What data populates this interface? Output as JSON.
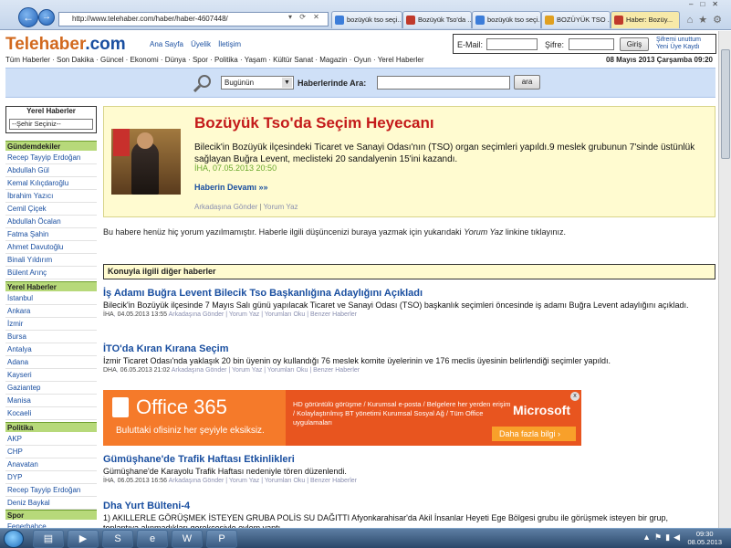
{
  "browser": {
    "url": "http://www.telehaber.com/haber/haber-4607448/",
    "tabs": [
      {
        "title": "bozüyük tso seçi...",
        "color": "#3c7dd9"
      },
      {
        "title": "Bozüyük Tso'da ...",
        "color": "#c0392b"
      },
      {
        "title": "bozüyük tso seçi...",
        "color": "#3c7dd9"
      },
      {
        "title": "BOZÜYÜK TSO ...",
        "color": "#e0a020"
      },
      {
        "title": "Haber: Bozüy...",
        "color": "#c0392b",
        "active": true
      }
    ]
  },
  "header": {
    "logo_main": "Telehaber",
    "logo_dot": ".com",
    "links": [
      "Ana Sayfa",
      "Üyelik",
      "İletişim"
    ],
    "email_label": "E-Mail:",
    "password_label": "Şifre:",
    "login_button": "Giriş",
    "forgot_line1": "Şifremi unuttum",
    "forgot_line2": "Yeni Üye Kaydı"
  },
  "nav": {
    "items": "Tüm Haberler · Son Dakika · Güncel · Ekonomi · Dünya · Spor · Politika · Yaşam · Kültür Sanat · Magazin · Oyun · Yerel Haberler",
    "date": "08 Mayıs 2013 Çarşamba 09:20"
  },
  "search": {
    "select_value": "Bugünün",
    "label": "Haberlerinde Ara:",
    "button": "ara"
  },
  "sidebar": {
    "regional_title": "Yerel Haberler",
    "regional_select": "--Şehir Seçiniz--",
    "sections": [
      {
        "title": "Gündemdekiler",
        "items": [
          "Recep Tayyip Erdoğan",
          "Abdullah Gül",
          "Kemal Kılıçdaroğlu",
          "İbrahim Yazıcı",
          "Cemil Çiçek",
          "Abdullah Öcalan",
          "Fatma Şahin",
          "Ahmet Davutoğlu",
          "Binali Yıldırım",
          "Bülent Arınç"
        ]
      },
      {
        "title": "Yerel Haberler",
        "items": [
          "İstanbul",
          "Ankara",
          "İzmir",
          "Bursa",
          "Antalya",
          "Adana",
          "Kayseri",
          "Gaziantep",
          "Manisa",
          "Kocaeli"
        ]
      },
      {
        "title": "Politika",
        "items": [
          "AKP",
          "CHP",
          "Anavatan",
          "DYP",
          "Recep Tayyip Erdoğan",
          "Deniz Baykal"
        ]
      },
      {
        "title": "Spor",
        "items": [
          "Fenerbahçe"
        ]
      }
    ]
  },
  "feature": {
    "title": "Bozüyük Tso'da Seçim Heyecanı",
    "summary": "Bilecik'in Bozüyük ilçesindeki Ticaret ve Sanayi Odası'nın (TSO) organ seçimleri yapıldı.9 meslek grubunun 7'sinde üstünlük sağlayan Buğra Levent, meclisteki 20 sandalyenin 15'ini kazandı.",
    "meta": "İHA, 07.05.2013 20:50",
    "more": "Haberin Devamı »»",
    "send": "Arkadaşına Gönder",
    "comment": "Yorum Yaz"
  },
  "no_comment": {
    "text_before": "Bu habere henüz hiç yorum yazılmamıştır. Haberle ilgili düşüncenizi buraya yazmak için yukarıdaki",
    "text_em": "Yorum Yaz",
    "text_after": "linkine tıklayınız."
  },
  "related": {
    "header": "Konuyla ilgili diğer haberler",
    "items": [
      {
        "title": "İş Adamı Buğra Levent Bilecik Tso Başkanlığına Adaylığını Açıkladı",
        "desc": "Bilecik'in Bozüyük ilçesinde 7 Mayıs Salı günü yapılacak Ticaret ve Sanayi Odası (TSO) başkanlık seçimleri öncesinde iş adamı Buğra Levent adaylığını açıkladı.",
        "source": "İHA",
        "date": "04.05.2013 13:55",
        "links": "Arkadaşına Gönder | Yorum Yaz | Yorumları Oku | Benzer Haberler"
      },
      {
        "title": "İTO'da Kıran Kırana Seçim",
        "desc": "İzmir Ticaret Odası'nda yaklaşık 20 bin üyenin oy kullandığı 76 meslek komite üyelerinin ve 176 meclis üyesinin belirlendiği seçimler yapıldı.",
        "source": "DHA",
        "date": "06.05.2013 21:02",
        "links": "Arkadaşına Gönder | Yorum Yaz | Yorumları Oku | Benzer Haberler"
      },
      {
        "title": "Gümüşhane'de Trafik Haftası Etkinlikleri",
        "desc": "Gümüşhane'de Karayolu Trafik Haftası nedeniyle tören düzenlendi.",
        "source": "İHA",
        "date": "06.05.2013 16:56",
        "links": "Arkadaşına Gönder | Yorum Yaz | Yorumları Oku | Benzer Haberler"
      },
      {
        "title": "Dha Yurt Bülteni-4",
        "desc": "1) AKILLERLE GÖRÜŞMEK İSTEYEN GRUBA POLİS SU DAĞITTI Afyonkarahisar'da Akil İnsanlar Heyeti Ege Bölgesi grubu ile görüşmek isteyen bir grup, toplantıya alınmadıkları gerekçesiyle eylem yaptı."
      }
    ]
  },
  "ad": {
    "logo": "Office 365",
    "tagline": "Buluttaki ofisiniz her şeyiyle eksiksiz.",
    "text": "HD görüntülü görüşme / Kurumsal e-posta / Belgelere her yerden erişim / Kolaylaştırılmış BT yönetimi Kurumsal Sosyal Ağ / Tüm Office uygulamaları",
    "brand": "Microsoft",
    "cta": "Daha fazla bilgi  ›",
    "close": "x"
  },
  "taskbar": {
    "time": "09:30",
    "date": "08.05.2013"
  }
}
